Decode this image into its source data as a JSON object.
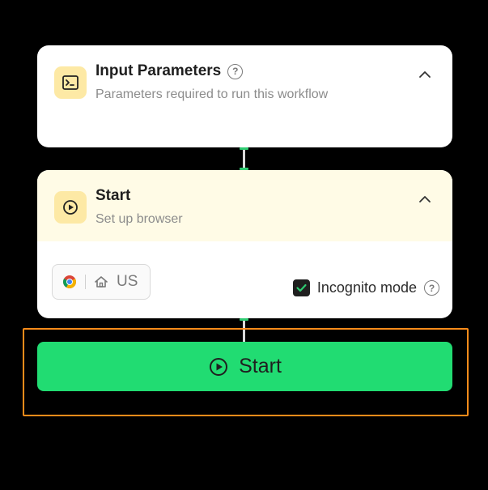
{
  "input_node": {
    "title": "Input Parameters",
    "subtitle": "Parameters required to run this workflow",
    "icon": "terminal-icon"
  },
  "start_node": {
    "title": "Start",
    "subtitle": "Set up browser",
    "icon": "play-circle-icon",
    "browser": {
      "icon": "chrome-icon",
      "region_icon": "home-icon",
      "region": "US"
    },
    "incognito": {
      "label": "Incognito mode",
      "checked": true
    }
  },
  "start_button": {
    "label": "Start",
    "icon": "play-circle-icon"
  },
  "colors": {
    "accent": "#21dc72",
    "highlight": "#ff8c1a",
    "node_icon_bg": "#fde9a5",
    "start_header_bg": "#fffbe6"
  }
}
